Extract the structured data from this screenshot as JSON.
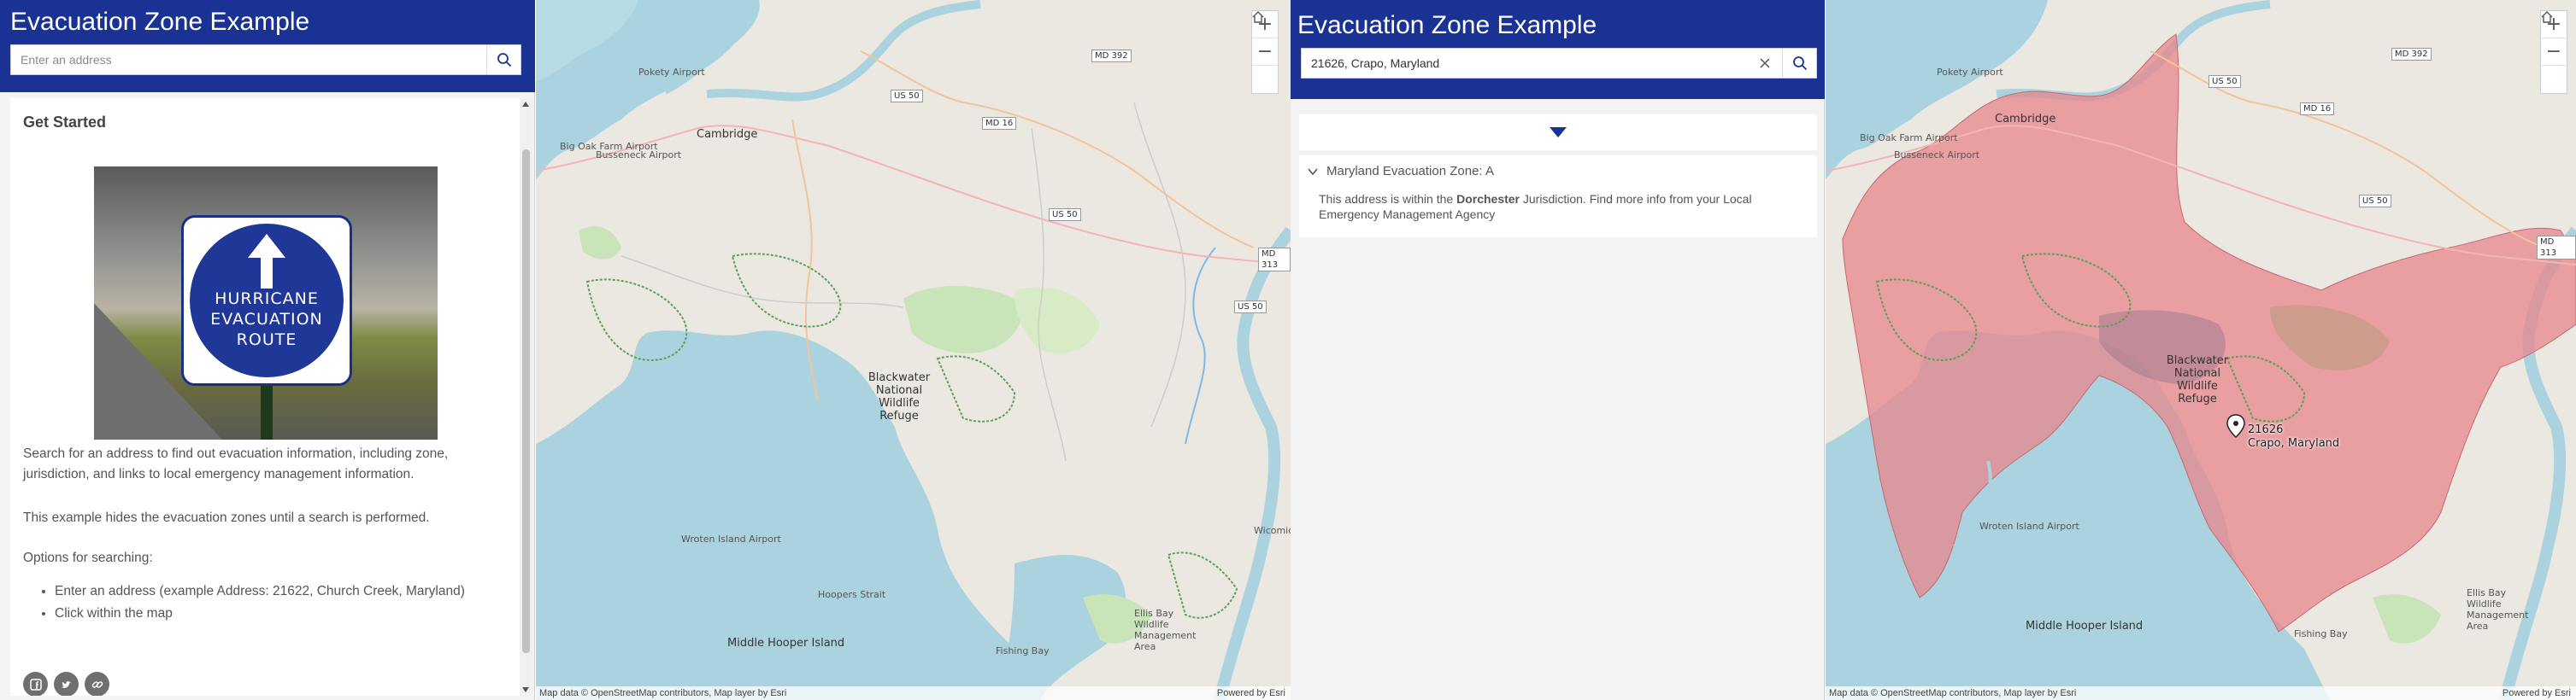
{
  "app_title": "Evacuation Zone Example",
  "left": {
    "search": {
      "placeholder": "Enter an address"
    },
    "panel": {
      "heading": "Get Started",
      "image_sign": {
        "line1": "HURRICANE",
        "line2": "EVACUATION",
        "line3": "ROUTE"
      },
      "para1": "Search for an address to find out evacuation information, including zone, jurisdiction, and links to local emergency management information.",
      "para2": "This example hides the evacuation zones until a search is performed.",
      "para3": "Options for searching:",
      "options": [
        "Enter an address (example Address: 21622, Church Creek, Maryland)",
        "Click within the map"
      ]
    },
    "map": {
      "attribution": "Map data © OpenStreetMap contributors, Map layer by Esri",
      "powered": "Powered by Esri",
      "labels": {
        "cambridge": "Cambridge",
        "pokety": "Pokety Airport",
        "big_oak": "Big Oak Farm Airport",
        "busseneck": "Busseneck Airport",
        "blackwater": "Blackwater National Wildlife Refuge",
        "wroten": "Wroten Island Airport",
        "middle_hooper": "Middle Hooper Island",
        "ellis_bay": "Ellis Bay Wildlife Management Area",
        "hoopers": "Hoopers Strait",
        "fishing_bay": "Fishing Bay",
        "wicomico": "Wicomico"
      },
      "shields": [
        "MD 392",
        "US 50",
        "MD 16",
        "US 50",
        "MD 313",
        "US 50"
      ]
    }
  },
  "right": {
    "search": {
      "value": "21626, Crapo, Maryland"
    },
    "result": {
      "title": "Maryland Evacuation Zone: A",
      "body_prefix": "This address is within the ",
      "jurisdiction": "Dorchester",
      "body_mid": " Jurisdiction.  Find ",
      "link": "more info",
      "body_suffix": " from your Local Emergency Management Agency"
    },
    "map": {
      "attribution": "Map data © OpenStreetMap contributors, Map layer by Esri",
      "powered": "Powered by Esri",
      "pin_line1": "21626",
      "pin_line2": "Crapo, Maryland",
      "labels": {
        "cambridge": "Cambridge",
        "pokety": "Pokety Airport",
        "big_oak": "Big Oak Farm Airport",
        "busseneck": "Busseneck Airport",
        "blackwater": "Blackwater National Wildlife Refuge",
        "wroten": "Wroten Island Airport",
        "middle_hooper": "Middle Hooper Island",
        "ellis_bay": "Ellis Bay Wildlife Management Area",
        "fishing_bay": "Fishing Bay"
      },
      "shields": [
        "US 50",
        "MD 392",
        "MD 16",
        "US 50",
        "MD 313"
      ]
    }
  },
  "colors": {
    "header": "#1a3294",
    "water": "#aad3df",
    "land": "#ebe8e1",
    "zone_a": "#e8868c",
    "park": "#c8e4b8"
  }
}
